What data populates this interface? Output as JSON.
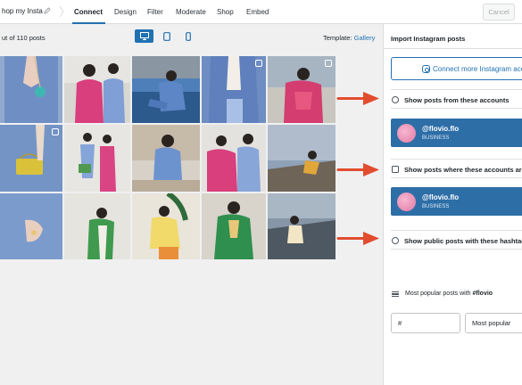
{
  "header": {
    "feed_name": "hop my Insta",
    "tabs": [
      {
        "label": "Connect",
        "active": true
      },
      {
        "label": "Design",
        "active": false
      },
      {
        "label": "Filter",
        "active": false
      },
      {
        "label": "Moderate",
        "active": false
      },
      {
        "label": "Shop",
        "active": false
      },
      {
        "label": "Embed",
        "active": false
      }
    ],
    "cancel_label": "Cancel"
  },
  "toolbar": {
    "posts_count": "ut of 110 posts",
    "devices": [
      "desktop-icon",
      "tablet-icon",
      "mobile-icon"
    ],
    "active_device": "desktop",
    "template_label": "Template:",
    "template_value": "Gallery"
  },
  "panel": {
    "title": "Import Instagram posts",
    "connect_label": "Connect more Instagram accou",
    "sources": [
      {
        "label": "Show posts from these accounts",
        "icon": "user-circle-icon"
      },
      {
        "label": "Show posts where these accounts are",
        "icon": "tag-user-icon"
      },
      {
        "label": "Show public posts with these hashtag",
        "icon": "hashtag-icon"
      }
    ],
    "accounts": [
      {
        "name": "@flovio.flo",
        "type": "BUSINESS"
      },
      {
        "name": "@flovio.flo",
        "type": "BUSINESS"
      }
    ],
    "popular_prefix": "Most popular posts with",
    "popular_tag": "#flovio",
    "hashtag_placeholder": "#",
    "sort_value": "Most popular"
  },
  "colors": {
    "accent": "#2271b1",
    "account_card": "#2e6ea7",
    "arrow": "#e24c2e"
  }
}
